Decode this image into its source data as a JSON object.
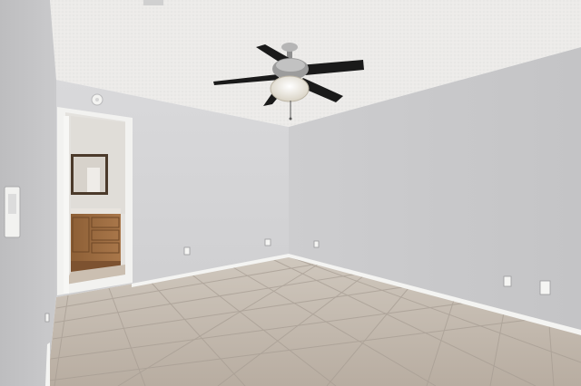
{
  "scene": {
    "description_type": "photo",
    "colors": {
      "ceiling": "#ecebe9",
      "left_wall": "#c9c9cb",
      "back_wall": "#d6d6d8",
      "right_wall": "#cfcfd1",
      "floor": "#c2b8ad",
      "grout": "#a89e94",
      "baseboard": "#f4f4f2",
      "door_frame": "#f2f2f0",
      "bathroom_wall": "#e2e0dc",
      "vanity_wood": "#9a6a3f",
      "fan_blade": "#1a1a1a",
      "fan_metal": "#9a9a9a",
      "light_globe": "#f1ede3"
    },
    "objects": [
      "ceiling-fan-icon",
      "bathroom-doorway",
      "bathroom-vanity",
      "mirror",
      "thermostat",
      "smoke-detector",
      "electrical-outlet",
      "tile-floor"
    ]
  }
}
